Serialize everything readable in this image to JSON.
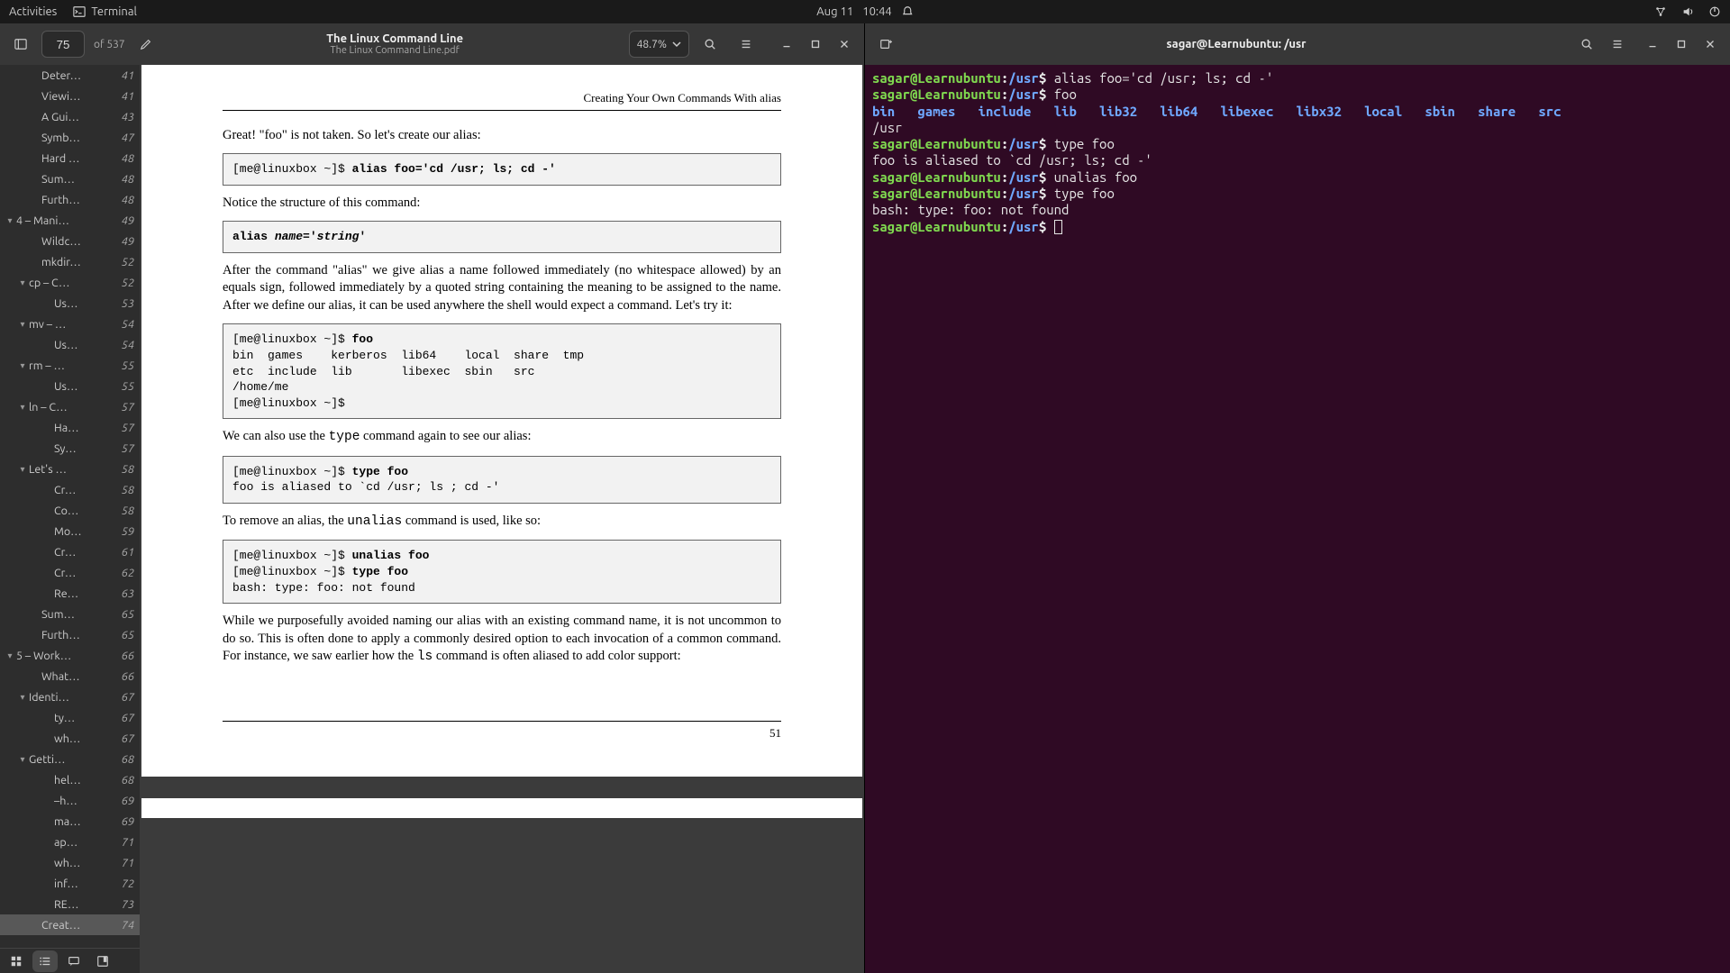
{
  "topbar": {
    "activities": "Activities",
    "terminal_label": "Terminal",
    "date": "Aug 11",
    "time": "10:44"
  },
  "pdf": {
    "current_page": "75",
    "total_pages": "of 537",
    "title": "The Linux Command Line",
    "subtitle": "The Linux Command Line.pdf",
    "zoom": "48.7%",
    "outline": [
      {
        "indent": 2,
        "caret": "",
        "label": "Deter…",
        "page": "41"
      },
      {
        "indent": 2,
        "caret": "",
        "label": "Viewi…",
        "page": "41"
      },
      {
        "indent": 2,
        "caret": "",
        "label": "A Gui…",
        "page": "43"
      },
      {
        "indent": 2,
        "caret": "",
        "label": "Symb…",
        "page": "47"
      },
      {
        "indent": 2,
        "caret": "",
        "label": "Hard …",
        "page": "48"
      },
      {
        "indent": 2,
        "caret": "",
        "label": "Sum…",
        "page": "48"
      },
      {
        "indent": 2,
        "caret": "",
        "label": "Furth…",
        "page": "48"
      },
      {
        "indent": 1,
        "caret": "▾",
        "label": "4 – Mani…",
        "page": "49"
      },
      {
        "indent": 2,
        "caret": "",
        "label": "Wildc…",
        "page": "49"
      },
      {
        "indent": 2,
        "caret": "",
        "label": "mkdir…",
        "page": "52"
      },
      {
        "indent": 2,
        "caret": "▾",
        "label": "cp – C…",
        "page": "52"
      },
      {
        "indent": 3,
        "caret": "",
        "label": "Us…",
        "page": "53"
      },
      {
        "indent": 2,
        "caret": "▾",
        "label": "mv – …",
        "page": "54"
      },
      {
        "indent": 3,
        "caret": "",
        "label": "Us…",
        "page": "54"
      },
      {
        "indent": 2,
        "caret": "▾",
        "label": "rm – …",
        "page": "55"
      },
      {
        "indent": 3,
        "caret": "",
        "label": "Us…",
        "page": "55"
      },
      {
        "indent": 2,
        "caret": "▾",
        "label": "ln – C…",
        "page": "57"
      },
      {
        "indent": 3,
        "caret": "",
        "label": "Ha…",
        "page": "57"
      },
      {
        "indent": 3,
        "caret": "",
        "label": "Sy…",
        "page": "57"
      },
      {
        "indent": 2,
        "caret": "▾",
        "label": "Let's …",
        "page": "58"
      },
      {
        "indent": 3,
        "caret": "",
        "label": "Cr…",
        "page": "58"
      },
      {
        "indent": 3,
        "caret": "",
        "label": "Co…",
        "page": "58"
      },
      {
        "indent": 3,
        "caret": "",
        "label": "Mo…",
        "page": "59"
      },
      {
        "indent": 3,
        "caret": "",
        "label": "Cr…",
        "page": "61"
      },
      {
        "indent": 3,
        "caret": "",
        "label": "Cr…",
        "page": "62"
      },
      {
        "indent": 3,
        "caret": "",
        "label": "Re…",
        "page": "63"
      },
      {
        "indent": 2,
        "caret": "",
        "label": "Sum…",
        "page": "65"
      },
      {
        "indent": 2,
        "caret": "",
        "label": "Furth…",
        "page": "65"
      },
      {
        "indent": 1,
        "caret": "▾",
        "label": "5 – Work…",
        "page": "66"
      },
      {
        "indent": 2,
        "caret": "",
        "label": "What…",
        "page": "66"
      },
      {
        "indent": 2,
        "caret": "▾",
        "label": "Identi…",
        "page": "67"
      },
      {
        "indent": 3,
        "caret": "",
        "label": "ty…",
        "page": "67"
      },
      {
        "indent": 3,
        "caret": "",
        "label": "wh…",
        "page": "67"
      },
      {
        "indent": 2,
        "caret": "▾",
        "label": "Getti…",
        "page": "68"
      },
      {
        "indent": 3,
        "caret": "",
        "label": "hel…",
        "page": "68"
      },
      {
        "indent": 3,
        "caret": "",
        "label": "–h…",
        "page": "69"
      },
      {
        "indent": 3,
        "caret": "",
        "label": "ma…",
        "page": "69"
      },
      {
        "indent": 3,
        "caret": "",
        "label": "ap…",
        "page": "71"
      },
      {
        "indent": 3,
        "caret": "",
        "label": "wh…",
        "page": "71"
      },
      {
        "indent": 3,
        "caret": "",
        "label": "inf…",
        "page": "72"
      },
      {
        "indent": 3,
        "caret": "",
        "label": "RE…",
        "page": "73"
      },
      {
        "indent": 2,
        "caret": "",
        "label": "Creat…",
        "page": "74",
        "active": true
      }
    ],
    "chapter_header": "Creating Your Own Commands With alias",
    "p_intro": "Great! \"foo\" is not taken. So let's create our alias:",
    "code1_prompt": "[me@linuxbox ~]$ ",
    "code1_cmd": "alias foo='cd /usr; ls; cd -'",
    "p_notice": "Notice the structure of this command:",
    "code2_a": "alias ",
    "code2_b_i": "name",
    "code2_c": "='",
    "code2_d_i": "string",
    "code2_e": "'",
    "p_after": "After the command \"alias\" we give alias a name followed immediately (no whitespace allowed) by an equals sign, followed immediately by a quoted string containing the meaning to be assigned to the name. After we define our alias, it can be used anywhere the shell would expect a command. Let's try it:",
    "code3_l1_p": "[me@linuxbox ~]$ ",
    "code3_l1_c": "foo",
    "code3_l2": "bin  games    kerberos  lib64    local  share  tmp",
    "code3_l3": "etc  include  lib       libexec  sbin   src",
    "code3_l4": "/home/me",
    "code3_l5": "[me@linuxbox ~]$",
    "p_type_a": "We can also use the ",
    "p_type_b": "type",
    "p_type_c": " command again to see our alias:",
    "code4_l1_p": "[me@linuxbox ~]$ ",
    "code4_l1_c": "type foo",
    "code4_l2": "foo is aliased to `cd /usr; ls ; cd -'",
    "p_unalias_a": "To remove an alias, the ",
    "p_unalias_b": "unalias",
    "p_unalias_c": " command is used, like so:",
    "code5_l1_p": "[me@linuxbox ~]$ ",
    "code5_l1_c": "unalias foo",
    "code5_l2_p": "[me@linuxbox ~]$ ",
    "code5_l2_c": "type foo",
    "code5_l3": "bash: type: foo: not found",
    "p_final_a": "While we purposefully avoided naming our alias with an existing command name, it is not uncommon to do so. This is often done to apply a commonly desired option to each invocation of a common command. For instance, we saw earlier how the ",
    "p_final_b": "ls",
    "p_final_c": " command is often aliased to add color support:",
    "page_num": "51"
  },
  "term": {
    "title": "sagar@Learnubuntu: /usr",
    "prompt_user": "sagar@Learnubuntu",
    "prompt_colon": ":",
    "prompt_path": "/usr",
    "prompt_dollar": "$ ",
    "cmd1": "alias foo='cd /usr; ls; cd -'",
    "cmd2": "foo",
    "ls_line": "bin   games   include   lib   lib32   lib64   libexec   libx32   local   sbin   share   src",
    "ls_dirs": [
      "bin",
      "games",
      "include",
      "lib",
      "lib32",
      "lib64",
      "libexec",
      "libx32",
      "local",
      "sbin",
      "share",
      "src"
    ],
    "out_usr": "/usr",
    "cmd3": "type foo",
    "out3": "foo is aliased to `cd /usr; ls; cd -'",
    "cmd4": "unalias foo",
    "cmd5": "type foo",
    "out5": "bash: type: foo: not found"
  }
}
